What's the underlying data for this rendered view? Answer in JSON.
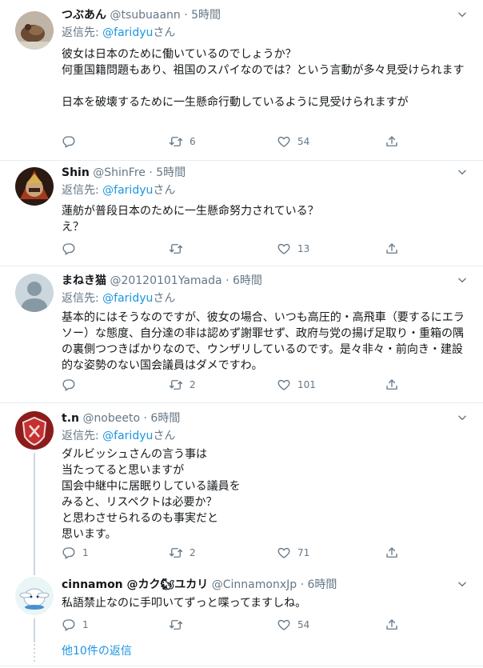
{
  "tweets": [
    {
      "name": "つぶあん",
      "handle": "@tsubuaann",
      "time": "5時間",
      "reply_prefix": "返信先: ",
      "reply_mention": "@faridyu",
      "reply_suffix": "さん",
      "text": "彼女は日本のために働いているのでしょうか？\n何重国籍問題もあり、祖国のスパイなのでは？という言動が多々見受けられます\n\n日本を破壊するために一生懸命行動しているように見受けられますが",
      "replies": "",
      "retweets": "6",
      "likes": "54"
    },
    {
      "name": "Shin",
      "handle": "@ShinFre",
      "time": "5時間",
      "reply_prefix": "返信先: ",
      "reply_mention": "@faridyu",
      "reply_suffix": "さん",
      "text": "蓮舫が普段日本のために一生懸命努力されている？\nえ？",
      "replies": "",
      "retweets": "",
      "likes": "13"
    },
    {
      "name": "まねき猫",
      "handle": "@20120101Yamada",
      "time": "6時間",
      "reply_prefix": "返信先: ",
      "reply_mention": "@faridyu",
      "reply_suffix": "さん",
      "text": "基本的にはそうなのですが、彼女の場合、いつも高圧的・高飛車（要するにエラソー）な態度、自分達の非は認めず謝罪せず、政府与党の揚げ足取り・重箱の隅の裏側つつきばかりなので、ウンザリしているのです。是々非々・前向き・建設的な姿勢のない国会議員はダメですわ。",
      "replies": "",
      "retweets": "2",
      "likes": "101"
    },
    {
      "name": "t.n",
      "handle": "@nobeeto",
      "time": "6時間",
      "reply_prefix": "返信先: ",
      "reply_mention": "@faridyu",
      "reply_suffix": "さん",
      "text": "ダルビッシュさんの言う事は\n当たってると思いますが\n国会中継中に居眠りしている議員を\nみると、リスペクトは必要か？\nと思わさせられるのも事実だと\n思います。",
      "replies": "1",
      "retweets": "2",
      "likes": "71"
    },
    {
      "name": "cinnamon @カク🐿ユカリ",
      "handle": "@CinnamonxJp",
      "time": "6時間",
      "reply_prefix": "",
      "reply_mention": "",
      "reply_suffix": "",
      "text": "私語禁止なのに手叩いてずっと喋ってますしね。",
      "replies": "1",
      "retweets": "",
      "likes": "54"
    }
  ],
  "more_replies": "他10件の返信",
  "colors": {
    "link": "#1b95e0",
    "secondary": "#657786",
    "border": "#e6ecf0",
    "thread_line": "#ccd6dd"
  },
  "icons": [
    "reply-icon",
    "retweet-icon",
    "like-icon",
    "share-icon",
    "chevron-down-icon"
  ]
}
